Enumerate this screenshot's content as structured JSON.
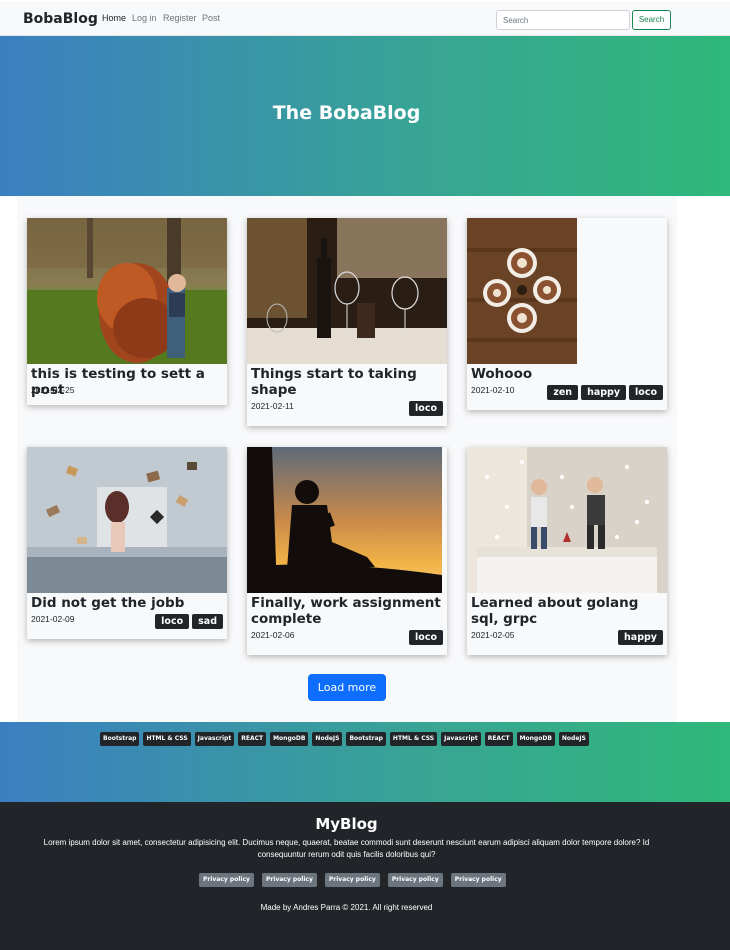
{
  "nav": {
    "brand": "BobaBlog",
    "links": [
      "Home",
      "Log in",
      "Register",
      "Post"
    ],
    "search_placeholder": "Search",
    "search_button": "Search"
  },
  "hero": {
    "title": "The BobaBlog"
  },
  "posts": [
    {
      "title": "this is testing to sett a post",
      "date": "2021-02-25",
      "tags": []
    },
    {
      "title": "Things start to taking shape",
      "date": "2021-02-11",
      "tags": [
        "loco"
      ]
    },
    {
      "title": "Wohooo",
      "date": "2021-02-10",
      "tags": [
        "zen",
        "happy",
        "loco"
      ]
    },
    {
      "title": "Did not get the jobb",
      "date": "2021-02-09",
      "tags": [
        "loco",
        "sad"
      ]
    },
    {
      "title": "Finally, work assignment complete",
      "date": "2021-02-06",
      "tags": [
        "loco"
      ]
    },
    {
      "title": "Learned about golang sql, grpc",
      "date": "2021-02-05",
      "tags": [
        "happy"
      ]
    }
  ],
  "load_more": "Load more",
  "tech_badges": [
    "Bootstrap",
    "HTML & CSS",
    "Javascript",
    "REACT",
    "MongoDB",
    "NodeJS",
    "Bootstrap",
    "HTML & CSS",
    "Javascript",
    "REACT",
    "MongoDB",
    "NodeJS"
  ],
  "footer": {
    "title": "MyBlog",
    "text": "Lorem ipsum dolor sit amet, consectetur adipisicing elit. Ducimus neque, quaerat, beatae commodi sunt deserunt nesciunt earum adipisci aliquam dolor tempore dolore? Id consequuntur rerum odit quis facilis doloribus qui?",
    "privacy_links": [
      "Privacy policy",
      "Privacy policy",
      "Privacy policy",
      "Privacy policy",
      "Privacy policy"
    ],
    "copyright": "Made by Andres Parra © 2021. All right reserved"
  },
  "colors": {
    "gradient_start": "#3b7fc1",
    "gradient_end": "#2fb87a",
    "dark": "#212529",
    "primary": "#0d6efd",
    "success": "#198754"
  }
}
